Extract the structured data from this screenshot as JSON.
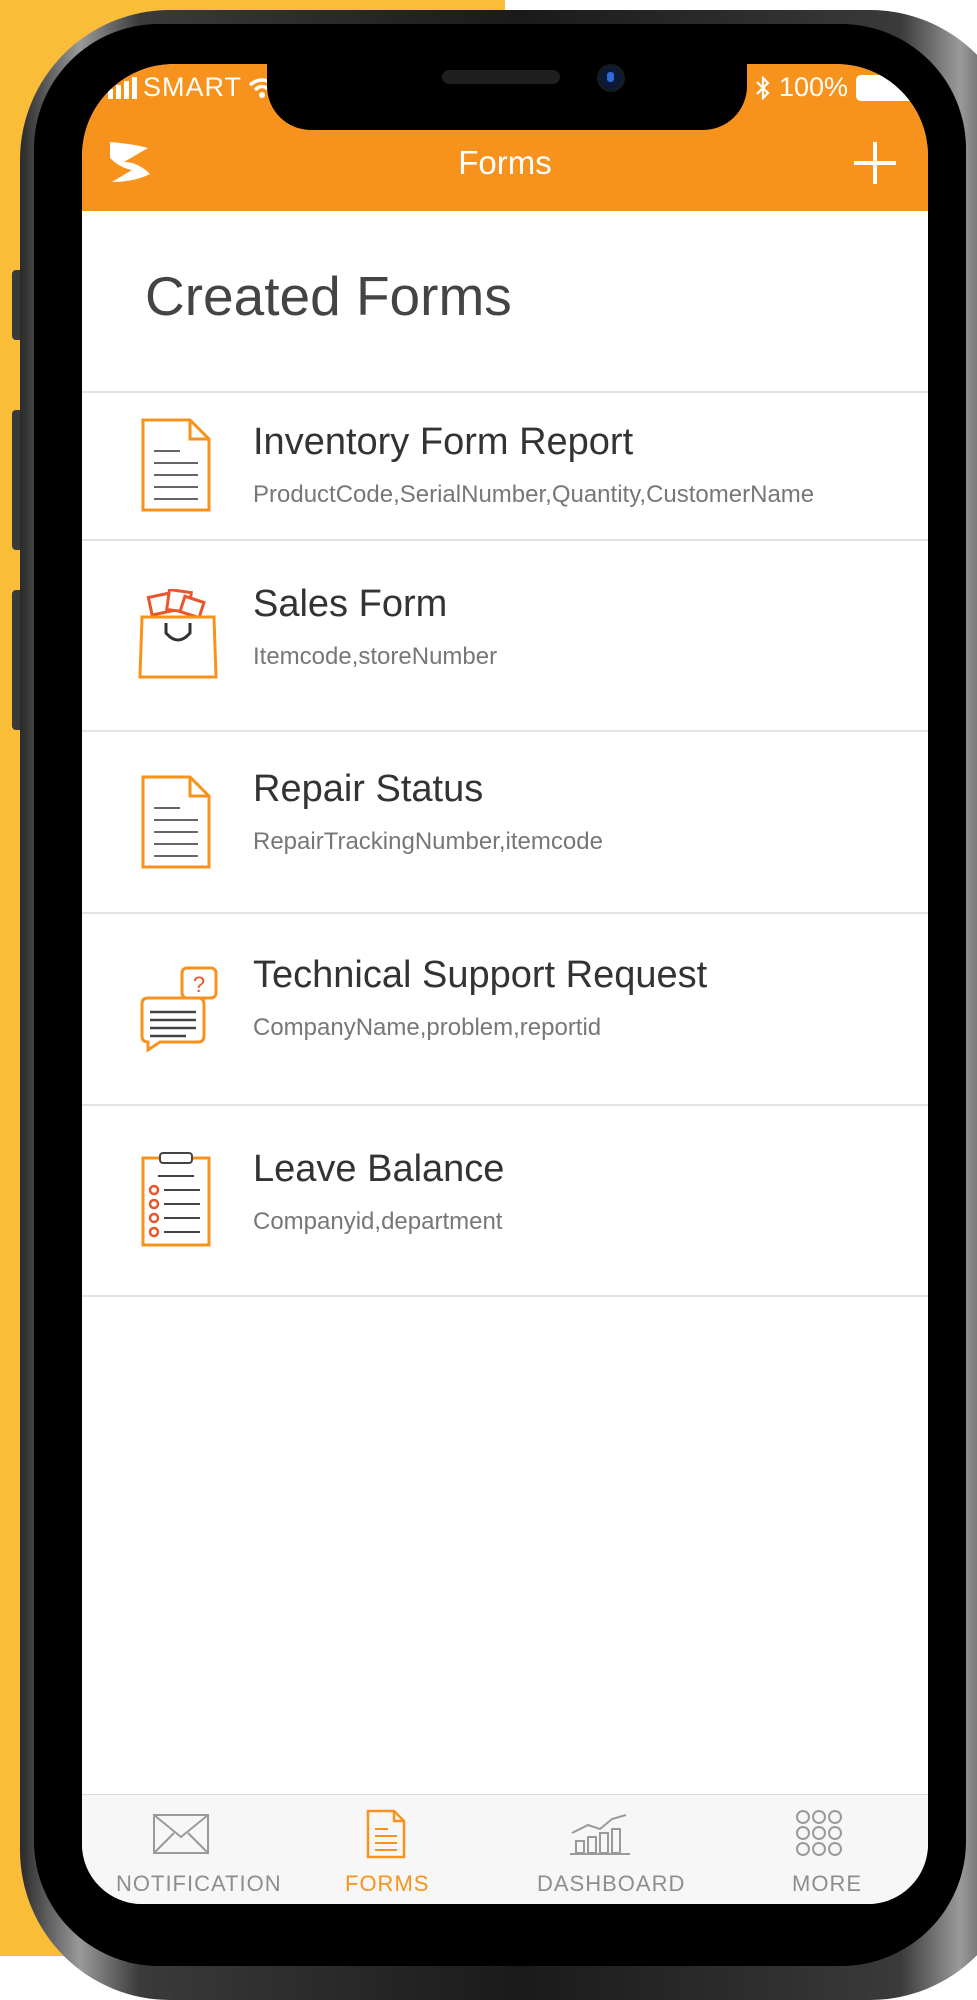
{
  "status_bar": {
    "carrier": "SMART",
    "battery": "100%"
  },
  "header": {
    "title": "Forms",
    "add_icon": "plus-icon",
    "logo_icon": "app-logo-icon",
    "background": "#F7931D"
  },
  "main": {
    "section_title": "Created Forms",
    "forms": [
      {
        "name": "Inventory Form Report",
        "fields": "ProductCode,SerialNumber,Quantity,CustomerName",
        "icon": "document-icon"
      },
      {
        "name": "Sales Form",
        "fields": "Itemcode,storeNumber",
        "icon": "shopping-bag-icon"
      },
      {
        "name": "Repair Status",
        "fields": "RepairTrackingNumber,itemcode",
        "icon": "document-icon"
      },
      {
        "name": "Technical Support Request",
        "fields": "CompanyName,problem,reportid",
        "icon": "support-chat-icon"
      },
      {
        "name": "Leave Balance",
        "fields": "Companyid,department",
        "icon": "checklist-icon"
      }
    ]
  },
  "tabbar": {
    "tabs": [
      {
        "label": "NOTIFICATION",
        "icon": "envelope-icon",
        "active": false
      },
      {
        "label": "FORMS",
        "icon": "form-icon",
        "active": true
      },
      {
        "label": "DASHBOARD",
        "icon": "chart-icon",
        "active": false
      },
      {
        "label": "MORE",
        "icon": "grid-dots-icon",
        "active": false
      }
    ]
  },
  "colors": {
    "accent": "#F7931D",
    "background_left": "#F9BD38",
    "icon_red": "#E8562A"
  }
}
